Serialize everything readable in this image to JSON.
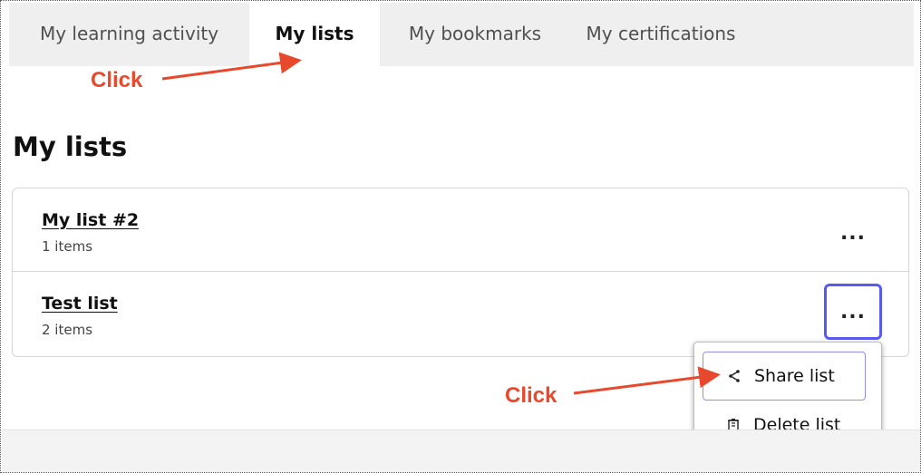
{
  "tabs": [
    {
      "label": "My learning activity"
    },
    {
      "label": "My lists"
    },
    {
      "label": "My bookmarks"
    },
    {
      "label": "My certifications"
    }
  ],
  "page_title": "My lists",
  "lists": [
    {
      "name": "My list #2",
      "count": "1 items",
      "more": "..."
    },
    {
      "name": "Test list",
      "count": "2 items",
      "more": "..."
    }
  ],
  "menu": {
    "share_label": "Share list",
    "delete_label": "Delete list",
    "share_icon": "share-icon",
    "delete_icon": "trash-icon"
  },
  "annotations": {
    "click1": "Click",
    "click2": "Click",
    "color": "#e8482c"
  },
  "colors": {
    "focus_ring": "#5a5af0",
    "tabbar_bg": "#efefef"
  }
}
